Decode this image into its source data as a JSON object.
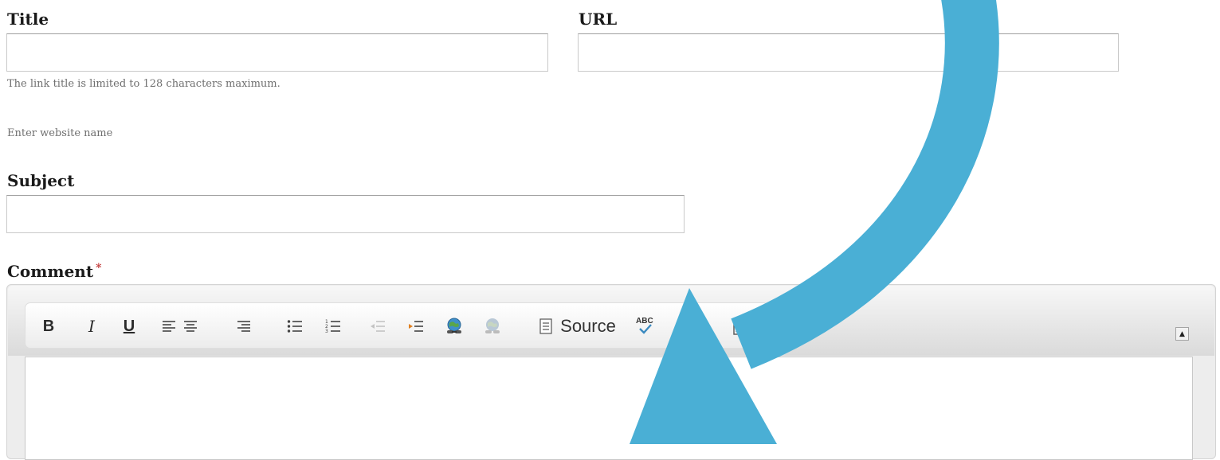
{
  "title_field": {
    "label": "Title",
    "value": "",
    "help": "The link title is limited to 128 characters maximum."
  },
  "url_field": {
    "label": "URL",
    "value": "",
    "help": "Enter website name"
  },
  "subject_field": {
    "label": "Subject",
    "value": ""
  },
  "comment_field": {
    "label": "Comment",
    "required_marker": "*",
    "value": "",
    "toolbar": {
      "bold_label": "B",
      "italic_label": "I",
      "underline_label": "U",
      "source_label": "Source",
      "spellcheck_label": "ABC",
      "collapse_label": "▲"
    }
  },
  "icons": [
    "bold-icon",
    "italic-icon",
    "underline-icon",
    "align-left-icon",
    "align-center-icon",
    "align-right-icon",
    "bulleted-list-icon",
    "numbered-list-icon",
    "outdent-icon",
    "indent-icon",
    "link-icon",
    "unlink-icon",
    "source-icon",
    "spellcheck-icon",
    "image-icon",
    "curved-arrow-icon"
  ],
  "colors": {
    "arrow": "#4aafd5",
    "required": "#c23a3a"
  }
}
